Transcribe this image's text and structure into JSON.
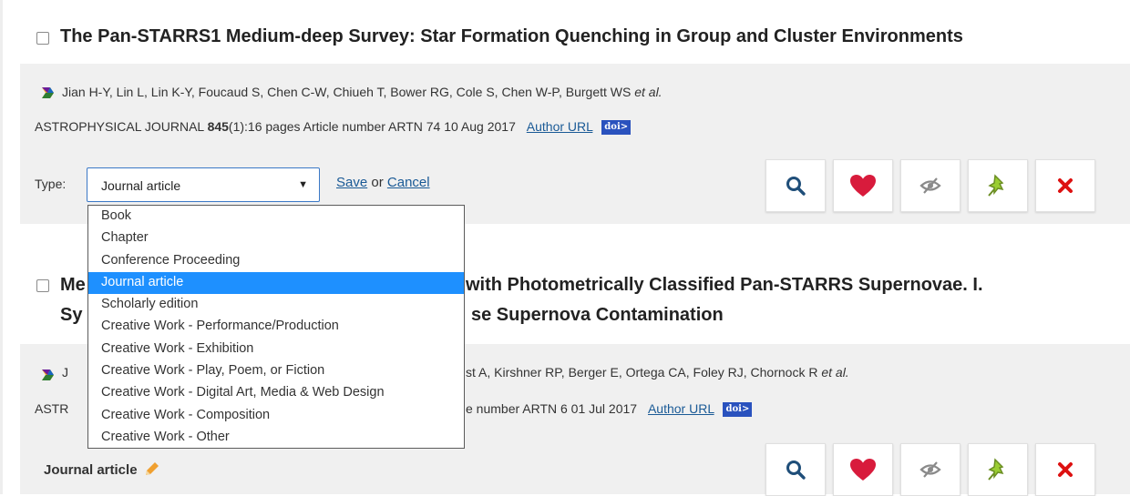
{
  "publications": [
    {
      "title": "The Pan-STARRS1 Medium-deep Survey: Star Formation Quenching in Group and Cluster Environments",
      "authors": "Jian H-Y, Lin L, Lin K-Y, Foucaud S, Chen C-W, Chiueh T, Bower RG, Cole S, Chen W-P, Burgett WS",
      "et_al": "et al.",
      "journal_name": "ASTROPHYSICAL JOURNAL",
      "volume": "845",
      "details": "(1):16 pages Article number ARTN 74 10 Aug 2017",
      "author_url_label": "Author URL",
      "doi_label": "doi>"
    },
    {
      "title_line1_start": "Me",
      "title_line1_end": "with Photometrically Classified Pan-STARRS Supernovae. I.",
      "title_line2_start": "Sy",
      "title_line2_end": "se Supernova Contamination",
      "authors_start": "J",
      "authors_end": "st A, Kirshner RP, Berger E, Ortega CA, Foley RJ, Chornock R",
      "et_al": "et al.",
      "journal_start": "ASTR",
      "journal_end": "e number ARTN 6 01 Jul 2017",
      "author_url_label": "Author URL",
      "doi_label": "doi>",
      "type_label": "Journal article"
    }
  ],
  "edit": {
    "type_label": "Type:",
    "selected_value": "Journal article",
    "save_label": "Save",
    "or_label": "or",
    "cancel_label": "Cancel"
  },
  "dropdown_options": [
    "Book",
    "Chapter",
    "Conference Proceeding",
    "Journal article",
    "Scholarly edition",
    "Creative Work - Performance/Production",
    "Creative Work - Exhibition",
    "Creative Work - Play, Poem, or Fiction",
    "Creative Work - Digital Art, Media & Web Design",
    "Creative Work - Composition",
    "Creative Work - Other"
  ],
  "selected_option_index": 3,
  "action_icons": [
    "search-icon",
    "heart-icon",
    "hide-icon",
    "pin-icon",
    "close-icon"
  ],
  "colors": {
    "band": "#f0f0f0",
    "link": "#1a5a96",
    "select_border": "#3b78c6",
    "selected_option": "#1e90ff",
    "search": "#1f4e79",
    "heart": "#d81b3c",
    "hide": "#8a8a8a",
    "pin": "#9acd32",
    "close": "#dd1111"
  }
}
